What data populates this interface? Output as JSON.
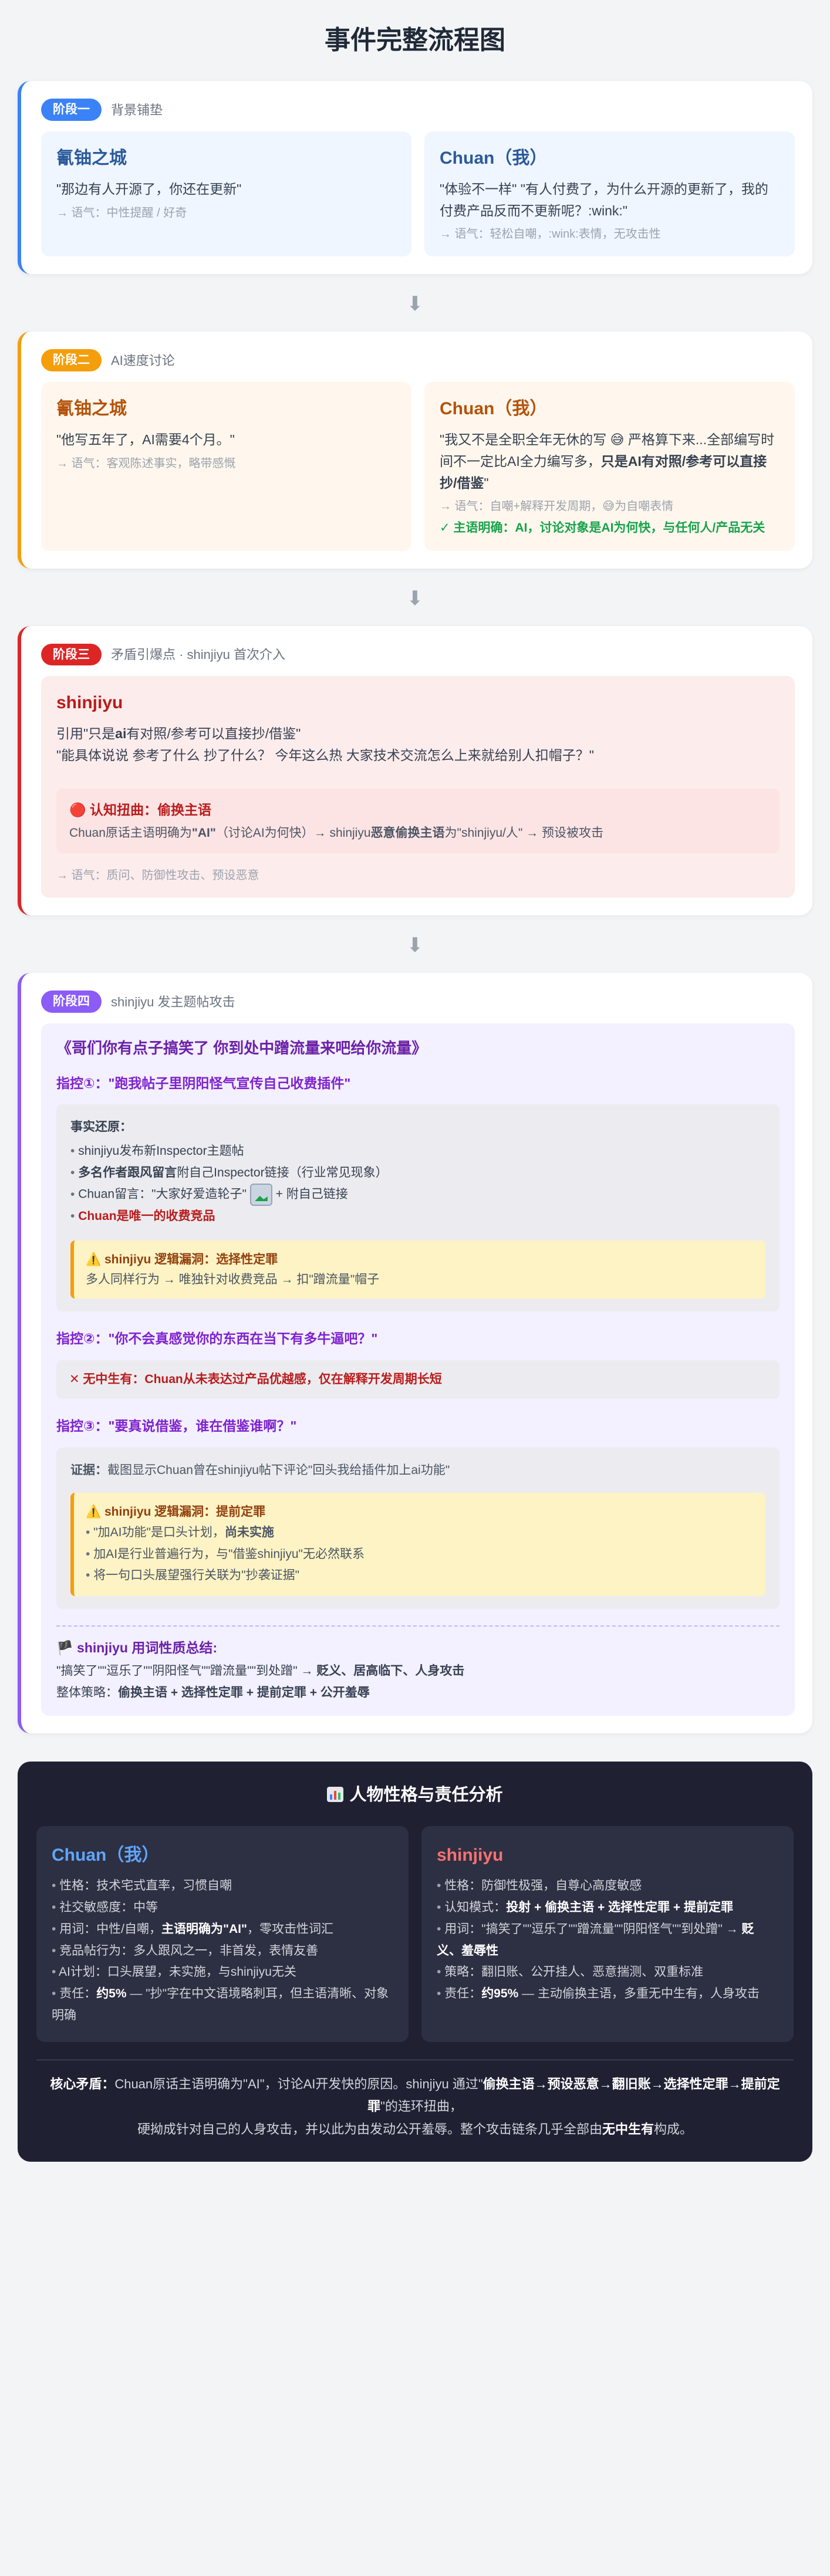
{
  "page_title": "事件完整流程图",
  "stage1": {
    "badge": "阶段一",
    "subtitle": "背景铺垫",
    "left": {
      "name": "氰铀之城",
      "quote": "\"那边有人开源了，你还在更新\"",
      "tone": "→ 语气：中性提醒 / 好奇"
    },
    "right": {
      "name": "Chuan（我）",
      "quote": "\"体验不一样\" \"有人付费了，为什么开源的更新了，我的付费产品反而不更新呢？:wink:\"",
      "tone": "→ 语气：轻松自嘲，:wink:表情，无攻击性"
    }
  },
  "stage2": {
    "badge": "阶段二",
    "subtitle": "AI速度讨论",
    "left": {
      "name": "氰铀之城",
      "quote": "\"他写五年了，AI需要4个月。\"",
      "tone": "→ 语气：客观陈述事实，略带感慨"
    },
    "right": {
      "name": "Chuan（我）",
      "quote_a": "\"我又不是全职全年无休的写 😅 严格算下来...全部编写时间不一定比AI全力编写多，",
      "quote_b": "只是AI有对照/参考可以直接抄/借鉴",
      "quote_c": "\"",
      "tone": "→ 语气：自嘲+解释开发周期，😅为自嘲表情",
      "note": "✓ 主语明确：AI，讨论对象是AI为何快，与任何人/产品无关"
    }
  },
  "stage3": {
    "badge": "阶段三",
    "subtitle": "矛盾引爆点 · shinjiyu 首次介入",
    "name": "shinjiyu",
    "line1_a": "引用\"只是",
    "line1_b": "ai",
    "line1_c": "有对照/参考可以直接抄/借鉴\"",
    "line2": "\"能具体说说 参考了什么 抄了什么？ 今年这么热 大家技术交流怎么上来就给别人扣帽子？\"",
    "warn_title": "🔴 认知扭曲：偷换主语",
    "warn_a": "Chuan原话主语明确为",
    "warn_b": "\"AI\"",
    "warn_c": "（讨论AI为何快）→ shinjiyu",
    "warn_d": "恶意偷换主语",
    "warn_e": "为\"shinjiyu/人\" → 预设被攻击",
    "tone": "→ 语气：质问、防御性攻击、预设恶意"
  },
  "stage4": {
    "badge": "阶段四",
    "subtitle": "shinjiyu 发主题帖攻击",
    "post_title": "《哥们你有点子搞笑了 你到处中蹭流量来吧给你流量》",
    "p1": "指控①：\"跑我帖子里阴阳怪气宣传自己收费插件\"",
    "facts_title": "事实还原：",
    "fact1": "shinjiyu发布新Inspector主题帖",
    "fact2_b": "多名作者跟风留言",
    "fact2_rest": "附自己Inspector链接（行业常见现象）",
    "fact3_a": "Chuan留言：\"大家好爱造轮子\"",
    "fact3_b": "+ 附自己链接",
    "fact4": "Chuan是唯一的收费竞品",
    "y1_title": "⚠️ shinjiyu 逻辑漏洞：选择性定罪",
    "y1_text": "多人同样行为 → 唯独针对收费竞品 → 扣\"蹭流量\"帽子",
    "p2": "指控②：\"你不会真感觉你的东西在当下有多牛逼吧？\"",
    "p2_box": "✕ 无中生有：Chuan从未表达过产品优越感，仅在解释开发周期长短",
    "p3": "指控③：\"要真说借鉴，谁在借鉴谁啊？\"",
    "ev_label": "证据：",
    "ev_text": "截图显示Chuan曾在shinjiyu帖下评论\"回头我给插件加上ai功能\"",
    "y2_title": "⚠️ shinjiyu 逻辑漏洞：提前定罪",
    "y2_i1_a": "\"加AI功能\"是口头计划，",
    "y2_i1_b": "尚未实施",
    "y2_i2": "加AI是行业普遍行为，与\"借鉴shinjiyu\"无必然联系",
    "y2_i3": "将一句口头展望强行关联为\"抄袭证据\"",
    "sum_title": "🏴 shinjiyu 用词性质总结:",
    "sum_line1_a": "\"搞笑了\"\"逗乐了\"\"阴阳怪气\"\"蹭流量\"\"到处蹭\" → ",
    "sum_line1_b": "贬义、居高临下、人身攻击",
    "sum_line2_a": "整体策略：",
    "sum_line2_b": "偷换主语 + 选择性定罪 + 提前定罪 + 公开羞辱"
  },
  "analysis": {
    "title": "人物性格与责任分析",
    "chuan": {
      "name": "Chuan（我）",
      "items": [
        {
          "a": "性格：技术宅式直率，习惯自嘲",
          "b": "",
          "c": ""
        },
        {
          "a": "社交敏感度：中等",
          "b": "",
          "c": ""
        },
        {
          "a": "用词：中性/自嘲，",
          "b": "主语明确为\"AI\"",
          "c": "，零攻击性词汇"
        },
        {
          "a": "竞品帖行为：多人跟风之一，非首发，表情友善",
          "b": "",
          "c": ""
        },
        {
          "a": "AI计划：口头展望，未实施，与shinjiyu无关",
          "b": "",
          "c": ""
        },
        {
          "a": "责任：",
          "b": "约5%",
          "c": " — \"抄\"字在中文语境略刺耳，但主语清晰、对象明确"
        }
      ]
    },
    "shinjiyu": {
      "name": "shinjiyu",
      "items": [
        {
          "a": "性格：防御性极强，自尊心高度敏感",
          "b": "",
          "c": ""
        },
        {
          "a": "认知模式：",
          "b": "投射 + 偷换主语 + 选择性定罪 + 提前定罪",
          "c": ""
        },
        {
          "a": "用词：\"搞笑了\"\"逗乐了\"\"蹭流量\"\"阴阳怪气\"\"到处蹭\" → ",
          "b": "贬义、羞辱性",
          "c": ""
        },
        {
          "a": "策略：翻旧账、公开挂人、恶意揣测、双重标准",
          "b": "",
          "c": ""
        },
        {
          "a": "责任：",
          "b": "约95%",
          "c": " — 主动偷换主语，多重无中生有，人身攻击"
        }
      ]
    },
    "core_a": "核心矛盾：",
    "core_b": "Chuan原话主语明确为\"AI\"",
    "core_c": "，讨论AI开发快的原因。shinjiyu 通过\"",
    "core_d": "偷换主语→预设恶意→翻旧账→选择性定罪→提前定罪",
    "core_e": "\"的连环扭曲，",
    "core_f": "硬拗成针对自己的人身攻击，并以此为由发动公开羞辱。整个攻击链条几乎全部由",
    "core_g": "无中生有",
    "core_h": "构成。"
  }
}
